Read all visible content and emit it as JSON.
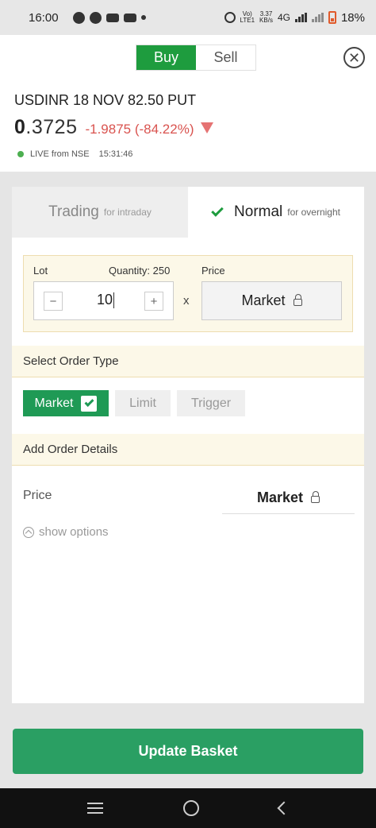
{
  "status_bar": {
    "time": "16:00",
    "network_top": "3.37",
    "network_bottom": "KB/s",
    "volte_top": "Vo)",
    "volte_bottom": "LTE1",
    "network_type": "4G",
    "battery": "18%"
  },
  "header": {
    "buy_label": "Buy",
    "sell_label": "Sell",
    "close_symbol": "✕"
  },
  "instrument": {
    "name": "USDINR 18 NOV 82.50 PUT",
    "ltp_int": "0",
    "ltp_dec": ".3725",
    "change": "-1.9875 (-84.22%)",
    "live_label": "LIVE from NSE",
    "live_time": "15:31:46"
  },
  "tabs": {
    "trading": {
      "label": "Trading",
      "sub": "for intraday"
    },
    "normal": {
      "label": "Normal",
      "sub": "for overnight"
    }
  },
  "order": {
    "lot_label": "Lot",
    "quantity_label": "Quantity: 250",
    "price_label": "Price",
    "minus": "−",
    "plus": "+",
    "lot_value": "10",
    "times": "x",
    "price_value": "Market"
  },
  "order_type": {
    "heading": "Select Order Type",
    "market": "Market",
    "limit": "Limit",
    "trigger": "Trigger"
  },
  "details": {
    "heading": "Add Order Details",
    "price_label": "Price",
    "price_value": "Market",
    "show_options": "show options"
  },
  "footer": {
    "update_button": "Update Basket"
  },
  "colors": {
    "buy_green": "#1e9c3e",
    "change_red": "#d9534f",
    "update_green": "#2a9f63"
  }
}
